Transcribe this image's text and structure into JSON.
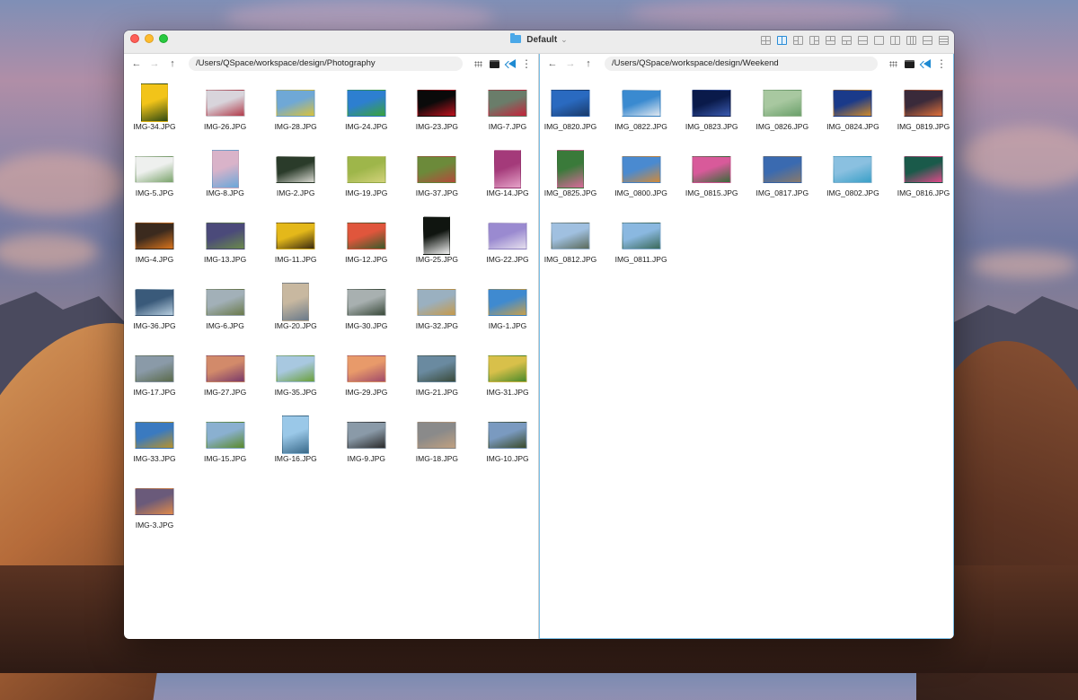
{
  "window": {
    "title": "Default",
    "layouts": [
      "grid-4",
      "split-vertical",
      "split-left-2",
      "split-right-2",
      "split-top-2",
      "split-4b",
      "split-horizontal",
      "single",
      "columns-2",
      "columns-3",
      "rows-2",
      "rows-3"
    ],
    "active_layout": 1
  },
  "left_pane": {
    "path": "/Users/QSpace/workspace/design/Photography",
    "files": [
      {
        "name": "IMG-34.JPG",
        "c1": "#f2c419",
        "c2": "#2f4a12",
        "portrait": true
      },
      {
        "name": "IMG-26.JPG",
        "c1": "#d8d4db",
        "c2": "#b23b4a",
        "portrait": false
      },
      {
        "name": "IMG-28.JPG",
        "c1": "#6fa8d6",
        "c2": "#d9c23b",
        "portrait": false
      },
      {
        "name": "IMG-24.JPG",
        "c1": "#2d7fd0",
        "c2": "#3aa33a",
        "portrait": false
      },
      {
        "name": "IMG-23.JPG",
        "c1": "#0a0a0a",
        "c2": "#c0121e",
        "portrait": false
      },
      {
        "name": "IMG-7.JPG",
        "c1": "#6a7d6a",
        "c2": "#c5233a",
        "portrait": false
      },
      {
        "name": "IMG-5.JPG",
        "c1": "#eef0ee",
        "c2": "#7aa36b",
        "portrait": false
      },
      {
        "name": "IMG-8.JPG",
        "c1": "#d9b3c9",
        "c2": "#6aa7d9",
        "portrait": true
      },
      {
        "name": "IMG-2.JPG",
        "c1": "#2a3b2a",
        "c2": "#d8d8d0",
        "portrait": false
      },
      {
        "name": "IMG-19.JPG",
        "c1": "#9eb64a",
        "c2": "#d2d27a",
        "portrait": false
      },
      {
        "name": "IMG-37.JPG",
        "c1": "#6c8a3a",
        "c2": "#b34a3a",
        "portrait": false
      },
      {
        "name": "IMG-14.JPG",
        "c1": "#a43a7a",
        "c2": "#e6a2c8",
        "portrait": true
      },
      {
        "name": "IMG-4.JPG",
        "c1": "#3b2a1e",
        "c2": "#d8731c",
        "portrait": false
      },
      {
        "name": "IMG-13.JPG",
        "c1": "#4b4a7a",
        "c2": "#6a8a4a",
        "portrait": false
      },
      {
        "name": "IMG-11.JPG",
        "c1": "#e4b81a",
        "c2": "#3a2a10",
        "portrait": false
      },
      {
        "name": "IMG-12.JPG",
        "c1": "#e0563c",
        "c2": "#3a5a2a",
        "portrait": false
      },
      {
        "name": "IMG-25.JPG",
        "c1": "#101510",
        "c2": "#f2f2f2",
        "portrait": true
      },
      {
        "name": "IMG-22.JPG",
        "c1": "#9a8ad0",
        "c2": "#e6e0ee",
        "portrait": false
      },
      {
        "name": "IMG-36.JPG",
        "c1": "#3a5a7a",
        "c2": "#b8cfe0",
        "portrait": false
      },
      {
        "name": "IMG-6.JPG",
        "c1": "#a2b0b8",
        "c2": "#6a7a4a",
        "portrait": false
      },
      {
        "name": "IMG-20.JPG",
        "c1": "#c8b8a0",
        "c2": "#6a7a8a",
        "portrait": true
      },
      {
        "name": "IMG-30.JPG",
        "c1": "#a8b0b0",
        "c2": "#3a4a3a",
        "portrait": false
      },
      {
        "name": "IMG-32.JPG",
        "c1": "#9ab0c0",
        "c2": "#c69a4a",
        "portrait": false
      },
      {
        "name": "IMG-1.JPG",
        "c1": "#3f8ad0",
        "c2": "#c8a04a",
        "portrait": false
      },
      {
        "name": "IMG-17.JPG",
        "c1": "#8a9aa8",
        "c2": "#5a6a4a",
        "portrait": false
      },
      {
        "name": "IMG-27.JPG",
        "c1": "#d28a6a",
        "c2": "#7a3a6a",
        "portrait": false
      },
      {
        "name": "IMG-35.JPG",
        "c1": "#a8c8e0",
        "c2": "#6aa03a",
        "portrait": false
      },
      {
        "name": "IMG-29.JPG",
        "c1": "#e89a6a",
        "c2": "#a04a6a",
        "portrait": false
      },
      {
        "name": "IMG-21.JPG",
        "c1": "#6a8aa0",
        "c2": "#3a4a3a",
        "portrait": false
      },
      {
        "name": "IMG-31.JPG",
        "c1": "#d8c04a",
        "c2": "#4a8a2a",
        "portrait": false
      },
      {
        "name": "IMG-33.JPG",
        "c1": "#3a7ac0",
        "c2": "#b8922a",
        "portrait": false
      },
      {
        "name": "IMG-15.JPG",
        "c1": "#8ab0d0",
        "c2": "#5a8a2a",
        "portrait": false
      },
      {
        "name": "IMG-16.JPG",
        "c1": "#9ac8e8",
        "c2": "#3a6a8a",
        "portrait": true
      },
      {
        "name": "IMG-9.JPG",
        "c1": "#8a9aa8",
        "c2": "#2a2a2a",
        "portrait": false
      },
      {
        "name": "IMG-18.JPG",
        "c1": "#8a8a8a",
        "c2": "#c0a080",
        "portrait": false
      },
      {
        "name": "IMG-10.JPG",
        "c1": "#7a9ac0",
        "c2": "#3a4a2a",
        "portrait": false
      },
      {
        "name": "IMG-3.JPG",
        "c1": "#6a5a7a",
        "c2": "#e08a4a",
        "portrait": false
      }
    ]
  },
  "right_pane": {
    "path": "/Users/QSpace/workspace/design/Weekend",
    "files": [
      {
        "name": "IMG_0820.JPG",
        "c1": "#2a6ac0",
        "c2": "#1a3a6a",
        "portrait": false
      },
      {
        "name": "IMG_0822.JPG",
        "c1": "#3a8ad0",
        "c2": "#e0e8f0",
        "portrait": false
      },
      {
        "name": "IMG_0823.JPG",
        "c1": "#0a1a4a",
        "c2": "#3a5ab0",
        "portrait": false
      },
      {
        "name": "IMG_0826.JPG",
        "c1": "#a8c8a0",
        "c2": "#6aa06a",
        "portrait": false
      },
      {
        "name": "IMG_0824.JPG",
        "c1": "#1a3a8a",
        "c2": "#d08a2a",
        "portrait": false
      },
      {
        "name": "IMG_0819.JPG",
        "c1": "#3a2a3a",
        "c2": "#e0703a",
        "portrait": false
      },
      {
        "name": "IMG_0825.JPG",
        "c1": "#3a7a3a",
        "c2": "#d86a9a",
        "portrait": true
      },
      {
        "name": "IMG_0800.JPG",
        "c1": "#4a8ad0",
        "c2": "#d08a3a",
        "portrait": false
      },
      {
        "name": "IMG_0815.JPG",
        "c1": "#d85a9a",
        "c2": "#3a6a3a",
        "portrait": false
      },
      {
        "name": "IMG_0817.JPG",
        "c1": "#3a6ab0",
        "c2": "#8a7a6a",
        "portrait": false
      },
      {
        "name": "IMG_0802.JPG",
        "c1": "#8ac0e0",
        "c2": "#3aa0c8",
        "portrait": false
      },
      {
        "name": "IMG_0816.JPG",
        "c1": "#1a5a4a",
        "c2": "#e04a8a",
        "portrait": false
      },
      {
        "name": "IMG_0812.JPG",
        "c1": "#a0c0e0",
        "c2": "#5a6a5a",
        "portrait": false
      },
      {
        "name": "IMG_0811.JPG",
        "c1": "#8ab8e0",
        "c2": "#3a6a5a",
        "portrait": false
      }
    ]
  }
}
